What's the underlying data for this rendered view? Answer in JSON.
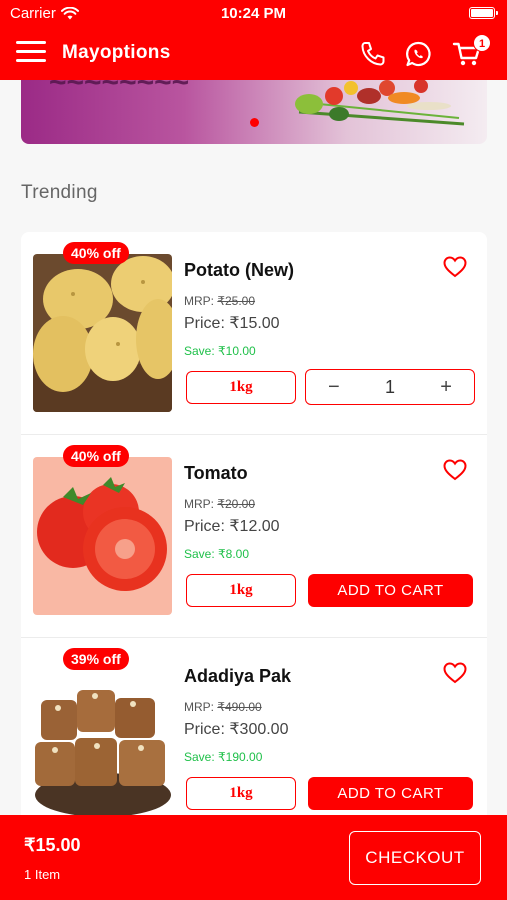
{
  "status_bar": {
    "carrier": "Carrier",
    "time": "10:24 PM"
  },
  "header": {
    "title": "Mayoptions",
    "cart_count": "1"
  },
  "section": {
    "title": "Trending"
  },
  "products": [
    {
      "name": "Potato (New)",
      "discount": "40% off",
      "mrp_label": "MRP:",
      "mrp": "₹25.00",
      "price_label": "Price:",
      "price": "₹15.00",
      "save_label": "Save:",
      "save": "₹10.00",
      "unit": "1kg",
      "qty": "1"
    },
    {
      "name": "Tomato",
      "discount": "40% off",
      "mrp_label": "MRP:",
      "mrp": "₹20.00",
      "price_label": "Price:",
      "price": "₹12.00",
      "save_label": "Save:",
      "save": "₹8.00",
      "unit": "1kg",
      "add_label": "ADD TO CART"
    },
    {
      "name": "Adadiya Pak",
      "discount": "39% off",
      "mrp_label": "MRP:",
      "mrp": "₹490.00",
      "price_label": "Price:",
      "price": "₹300.00",
      "save_label": "Save:",
      "save": "₹190.00",
      "unit": "1kg",
      "add_label": "ADD TO CART"
    }
  ],
  "stepper": {
    "minus": "−",
    "plus": "+"
  },
  "bottom": {
    "total": "₹15.00",
    "items": "1 Item",
    "checkout": "CHECKOUT"
  },
  "icons": [
    "menu-icon",
    "phone-icon",
    "whatsapp-icon",
    "cart-icon",
    "heart-icon",
    "wifi-icon",
    "battery-icon"
  ],
  "colors": {
    "primary": "#fe0000",
    "save": "#20c04a"
  }
}
